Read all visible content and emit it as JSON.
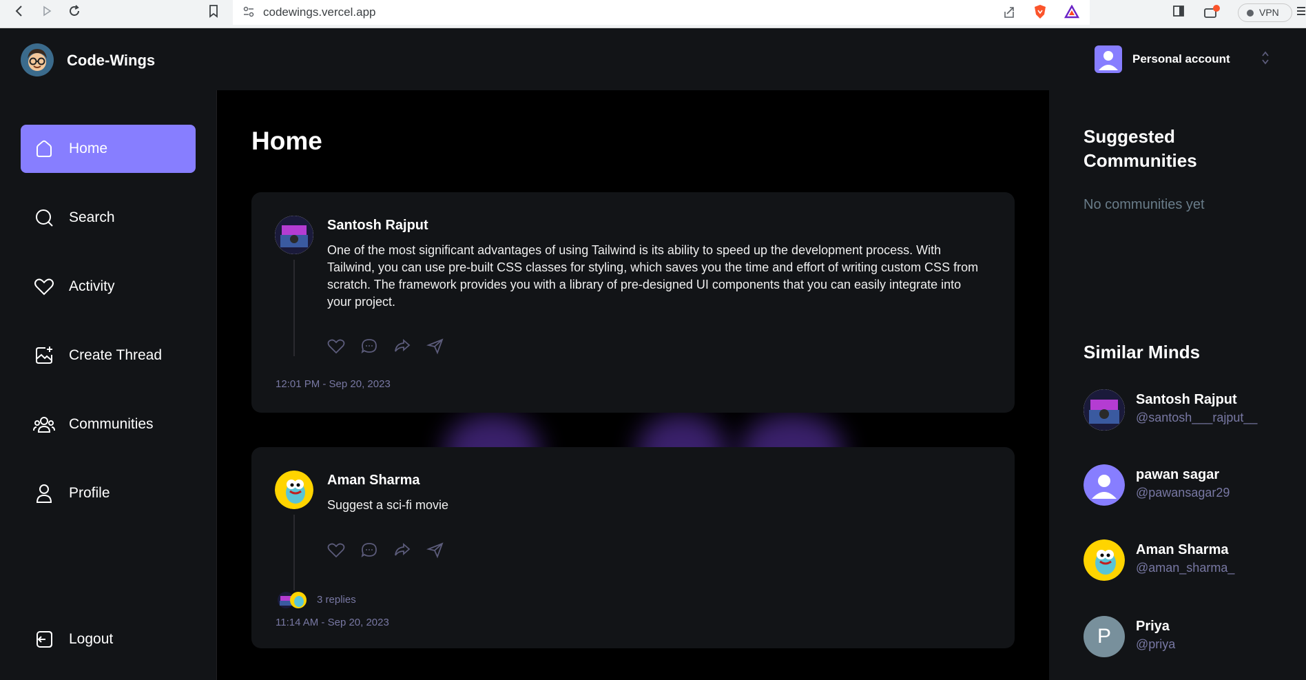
{
  "browser": {
    "url": "codewings.vercel.app",
    "vpn_label": "VPN"
  },
  "app": {
    "brand": "Code-Wings",
    "account_label": "Personal account"
  },
  "nav": {
    "items": [
      {
        "label": "Home",
        "icon": "home-icon",
        "active": true
      },
      {
        "label": "Search",
        "icon": "search-icon",
        "active": false
      },
      {
        "label": "Activity",
        "icon": "heart-icon",
        "active": false
      },
      {
        "label": "Create Thread",
        "icon": "create-thread-icon",
        "active": false
      },
      {
        "label": "Communities",
        "icon": "communities-icon",
        "active": false
      },
      {
        "label": "Profile",
        "icon": "user-icon",
        "active": false
      }
    ],
    "logout_label": "Logout"
  },
  "main": {
    "title": "Home",
    "posts": [
      {
        "author": "Santosh Rajput",
        "text": "One of the most significant advantages of using Tailwind is its ability to speed up the development process. With Tailwind, you can use pre-built CSS classes for styling, which saves you the time and effort of writing custom CSS from scratch. The framework provides you with a library of pre-designed UI components that you can easily integrate into your project.",
        "timestamp": "12:01 PM - Sep 20, 2023"
      },
      {
        "author": "Aman Sharma",
        "text": "Suggest a sci-fi movie",
        "replies": "3 replies",
        "timestamp": "11:14 AM - Sep 20, 2023"
      }
    ]
  },
  "right": {
    "suggested_title_line1": "Suggested",
    "suggested_title_line2": "Communities",
    "no_communities": "No communities yet",
    "similar_title": "Similar Minds",
    "minds": [
      {
        "name": "Santosh Rajput",
        "handle": "@santosh___rajput__"
      },
      {
        "name": "pawan sagar",
        "handle": "@pawansagar29"
      },
      {
        "name": "Aman Sharma",
        "handle": "@aman_sharma_"
      },
      {
        "name": "Priya",
        "handle": "@priya",
        "initial": "P"
      }
    ]
  },
  "colors": {
    "accent": "#877eff",
    "bg_dark": "#121417",
    "bg_main": "#000000",
    "muted": "#7878a3"
  }
}
